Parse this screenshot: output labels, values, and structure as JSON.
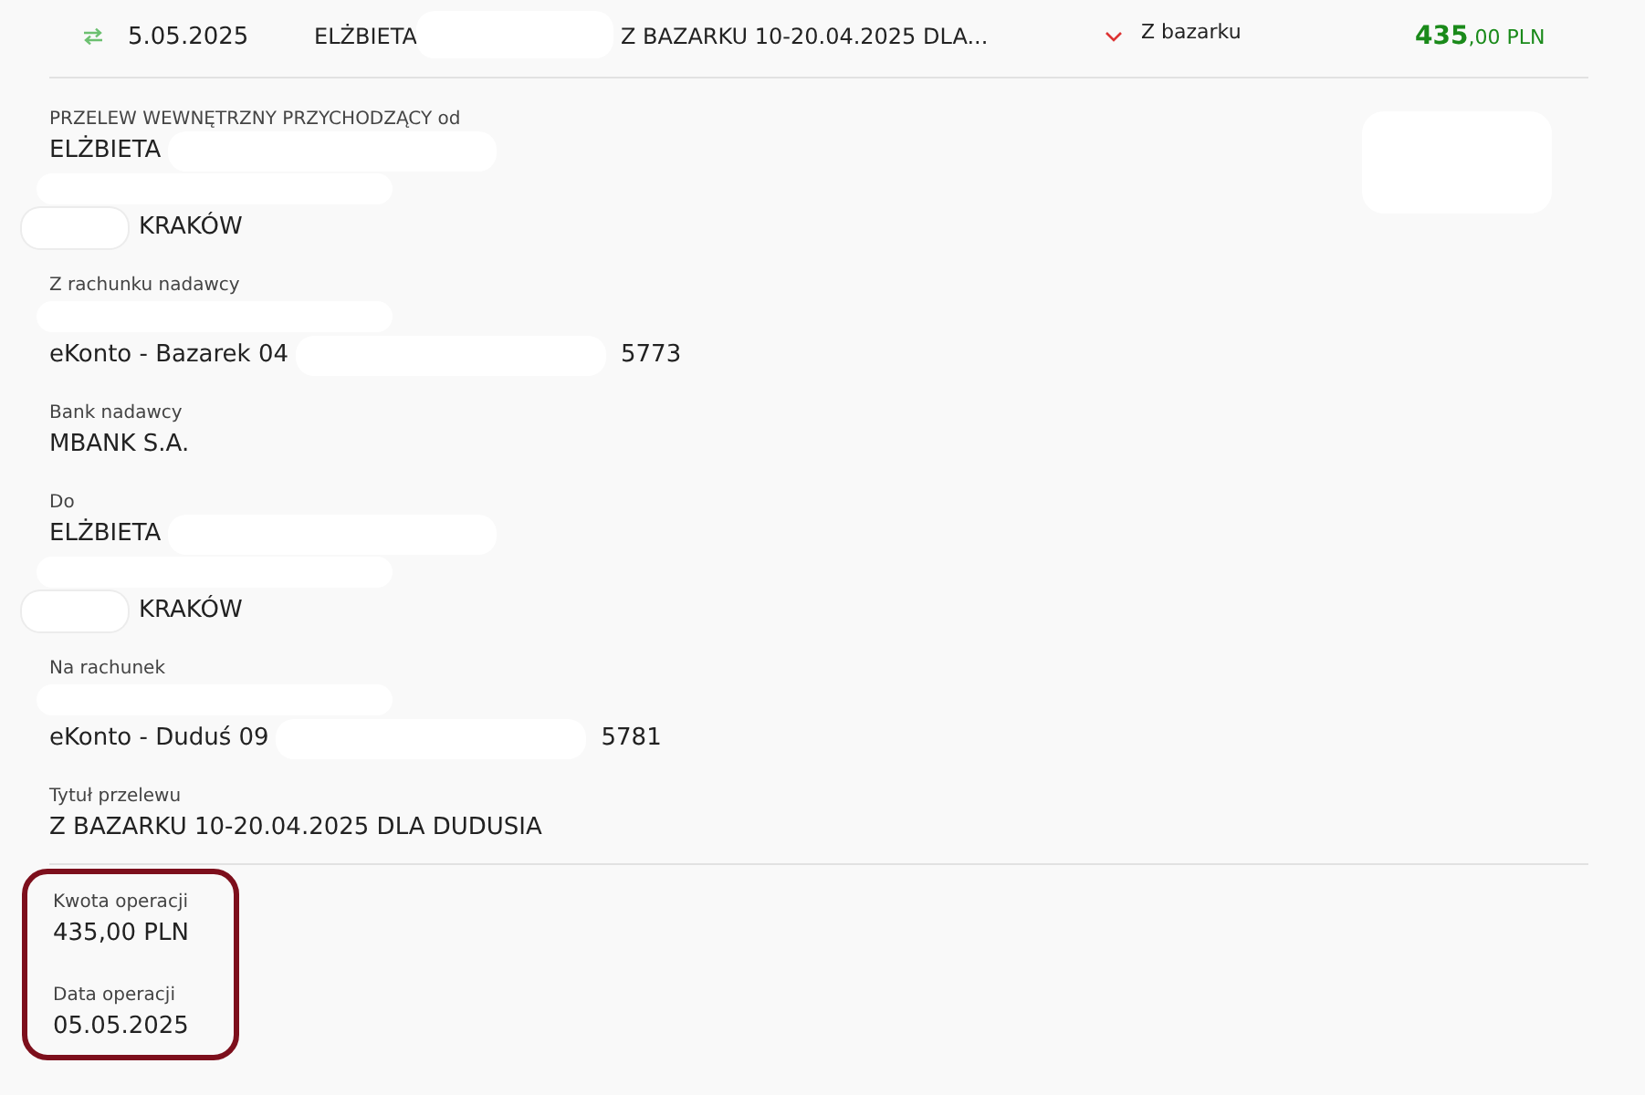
{
  "transaction": {
    "date": "5.05.2025",
    "counterparty": "ELŻBIETA",
    "title": "Z BAZARKU 10-20.04.2025 DLA...",
    "category": "Z bazarku",
    "amount_whole": "435",
    "amount_fraction": ",00 PLN",
    "expanded": true
  },
  "details": [
    {
      "label": "PRZELEW WEWNĘTRZNY PRZYCHODZĄCY od",
      "lines": [
        [
          {
            "kind": "text",
            "text": "ELŻBIETA"
          },
          {
            "kind": "redaction"
          }
        ],
        [
          {
            "kind": "redaction"
          }
        ],
        [
          {
            "kind": "redaction_lead"
          },
          {
            "kind": "text",
            "text": "KRAKÓW"
          }
        ]
      ]
    },
    {
      "label": "Z rachunku nadawcy",
      "lines": [
        [
          {
            "kind": "redaction"
          }
        ],
        [
          {
            "kind": "text",
            "text": "eKonto - Bazarek 04"
          },
          {
            "kind": "redaction"
          },
          {
            "kind": "text",
            "text": "5773"
          }
        ]
      ]
    },
    {
      "label": "Bank nadawcy",
      "lines": [
        [
          {
            "kind": "text",
            "text": "MBANK S.A."
          }
        ]
      ]
    },
    {
      "label": "Do",
      "lines": [
        [
          {
            "kind": "text",
            "text": "ELŻBIETA"
          },
          {
            "kind": "redaction"
          }
        ],
        [
          {
            "kind": "redaction"
          }
        ],
        [
          {
            "kind": "redaction_lead"
          },
          {
            "kind": "text",
            "text": "KRAKÓW"
          }
        ]
      ]
    },
    {
      "label": "Na rachunek",
      "lines": [
        [
          {
            "kind": "redaction"
          }
        ],
        [
          {
            "kind": "text",
            "text": "eKonto - Duduś 09"
          },
          {
            "kind": "redaction"
          },
          {
            "kind": "text",
            "text": "5781"
          }
        ]
      ]
    },
    {
      "label": "Tytuł przelewu",
      "lines": [
        [
          {
            "kind": "text",
            "text": "Z BAZARKU 10-20.04.2025 DLA DUDUSIA"
          }
        ]
      ]
    }
  ],
  "summary": [
    {
      "label": "Kwota operacji",
      "value": "435,00 PLN"
    },
    {
      "label": "Data operacji",
      "value": "05.05.2025"
    }
  ]
}
